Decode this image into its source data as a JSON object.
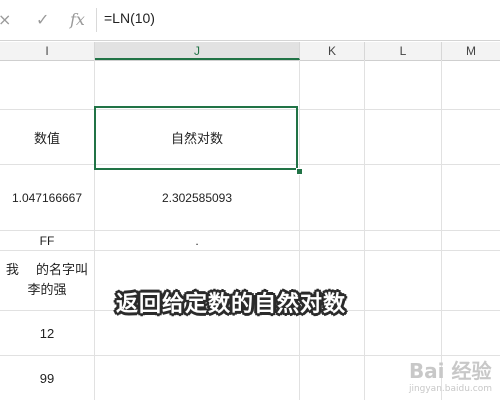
{
  "formula_bar": {
    "cancel_icon": "×",
    "confirm_icon": "✓",
    "fx_icon": "fx",
    "formula": "=LN(10)"
  },
  "columns": [
    "I",
    "J",
    "K",
    "L",
    "M"
  ],
  "cells": {
    "header_value": "数值",
    "header_ln": "自然对数",
    "i_value": "1.047166667",
    "j_value": "2.302585093",
    "i_ff": "FF",
    "j_dot": ".",
    "i_name_line1": "我　 的名字叫",
    "i_name_line2": "李的强",
    "i_12": "12",
    "i_99": "99"
  },
  "caption": "返回给定数的自然对数",
  "watermark": {
    "brand": "Bai 经验",
    "url": "jingyan.baidu.com"
  },
  "colors": {
    "accent": "#217346",
    "grid": "#e1e1e1"
  }
}
